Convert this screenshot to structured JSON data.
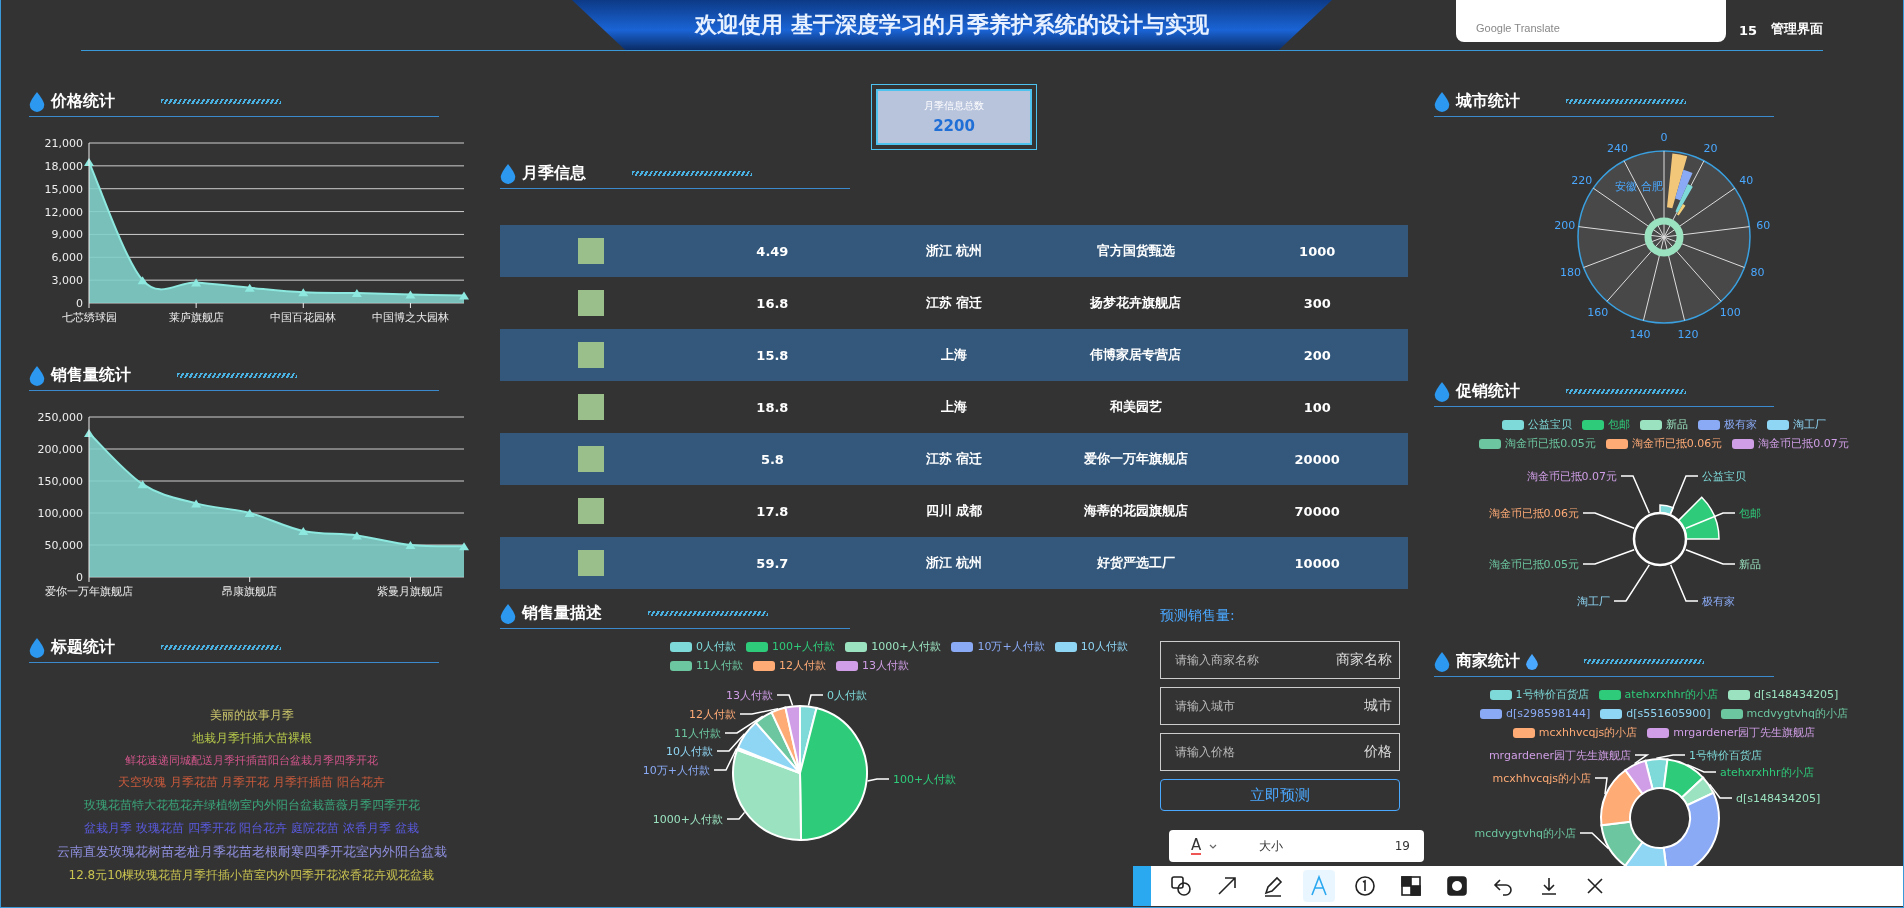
{
  "header": {
    "title": "欢迎使用 基于深度学习的月季养护系统的设计与实现",
    "time_fragment": "15",
    "admin_label": "管理界面"
  },
  "translate_popup": {
    "label": "Google Translate"
  },
  "price_stats": {
    "title": "价格统计",
    "chart_data": {
      "type": "area",
      "categories": [
        "七芯绣球园",
        null,
        "莱庐旗舰店",
        null,
        "中国百花园林",
        null,
        "中国博之大园林",
        null
      ],
      "values": [
        18500,
        3000,
        2700,
        2000,
        1400,
        1300,
        1100,
        1000
      ],
      "ylim": [
        0,
        21000
      ],
      "grid": true,
      "yticks": [
        {
          "value": 0,
          "label": "0"
        },
        {
          "value": 3000,
          "label": "3,000"
        },
        {
          "value": 6000,
          "label": "6,000"
        },
        {
          "value": 9000,
          "label": "9,000"
        },
        {
          "value": 12000,
          "label": "12,000"
        },
        {
          "value": 15000,
          "label": "15,000"
        },
        {
          "value": 18000,
          "label": "18,000"
        },
        {
          "value": 21000,
          "label": "21,000"
        }
      ]
    }
  },
  "sales_stats": {
    "title": "销售量统计",
    "chart_data": {
      "type": "area",
      "categories": [
        "爱你一万年旗舰店",
        null,
        null,
        "昂康旗舰店",
        null,
        null,
        "紫曼月旗舰店",
        null
      ],
      "values": [
        225000,
        145000,
        115000,
        100000,
        72000,
        65000,
        50000,
        48000
      ],
      "ylim": [
        0,
        250000
      ],
      "grid": true,
      "yticks": [
        {
          "value": 0,
          "label": "0"
        },
        {
          "value": 50000,
          "label": "50,000"
        },
        {
          "value": 100000,
          "label": "100,000"
        },
        {
          "value": 150000,
          "label": "150,000"
        },
        {
          "value": 200000,
          "label": "200,000"
        },
        {
          "value": 250000,
          "label": "250,000"
        }
      ]
    }
  },
  "title_stats": {
    "title": "标题统计",
    "words": [
      {
        "text": "美丽的故事月季",
        "color": "#c9c46a"
      },
      {
        "text": "地栽月季扦插大苗裸根",
        "color": "#b7c84a"
      },
      {
        "text": "鲜花速递同城配送月季扦插苗阳台盆栽月季四季开花",
        "color": "#d0558a"
      },
      {
        "text": "天空玫瑰 月季花苗 月季开花 月季扦插苗 阳台花卉",
        "color": "#c85a3c"
      },
      {
        "text": "玫瑰花苗特大花苞花卉绿植物室内外阳台盆栽蔷薇月季四季开花",
        "color": "#3aa57a"
      },
      {
        "text": "盆栽月季 玫瑰花苗 四季开花 阳台花卉 庭院花苗 浓香月季 盆栽",
        "color": "#5a5ae0"
      },
      {
        "text": "云南直发玫瑰花树苗老桩月季花苗老根耐寒四季开花室内外阳台盆栽",
        "color": "#8f8fe0"
      },
      {
        "text": "12.8元10棵玫瑰花苗月季扦插小苗室内外四季开花浓香花卉观花盆栽",
        "color": "#c9c350"
      }
    ]
  },
  "total": {
    "label": "月季信息总数",
    "value": "2200"
  },
  "flower_info": {
    "title": "月季信息",
    "rows": [
      {
        "price": "4.49",
        "city": "浙江 杭州",
        "shop": "官方国货甄选",
        "sales": "1000"
      },
      {
        "price": "16.8",
        "city": "江苏 宿迁",
        "shop": "扬梦花卉旗舰店",
        "sales": "300"
      },
      {
        "price": "15.8",
        "city": "上海",
        "shop": "伟博家居专营店",
        "sales": "200"
      },
      {
        "price": "18.8",
        "city": "上海",
        "shop": "和美园艺",
        "sales": "100"
      },
      {
        "price": "5.8",
        "city": "江苏 宿迁",
        "shop": "爱你一万年旗舰店",
        "sales": "20000"
      },
      {
        "price": "17.8",
        "city": "四川 成都",
        "shop": "海蒂的花园旗舰店",
        "sales": "70000"
      },
      {
        "price": "59.7",
        "city": "浙江 杭州",
        "shop": "好货严选工厂",
        "sales": "10000"
      }
    ]
  },
  "sales_desc": {
    "title": "销售量描述",
    "legend": [
      {
        "label": "0人付款",
        "color": "#7ed9d9"
      },
      {
        "label": "100+人付款",
        "color": "#2ecc7a"
      },
      {
        "label": "1000+人付款",
        "color": "#9be3c0"
      },
      {
        "label": "10万+人付款",
        "color": "#8aaaf5"
      },
      {
        "label": "10人付款",
        "color": "#8fd6f5"
      },
      {
        "label": "11人付款",
        "color": "#6cc6a0"
      },
      {
        "label": "12人付款",
        "color": "#ffab76"
      },
      {
        "label": "13人付款",
        "color": "#d09ee6"
      }
    ],
    "callouts": [
      "13人付款",
      "0人付款",
      "12人付款",
      "11人付款",
      "10人付款",
      "10万+人付款",
      "100+人付款",
      "1000+人付款"
    ]
  },
  "prediction": {
    "title": "预测销售量:",
    "fields": [
      {
        "placeholder": "请输入商家名称",
        "label": "商家名称"
      },
      {
        "placeholder": "请输入城市",
        "label": "城市"
      },
      {
        "placeholder": "请输入价格",
        "label": "价格"
      }
    ],
    "button": "立即预测"
  },
  "city_stats": {
    "title": "城市统计",
    "angle_ticks": [
      "0",
      "20",
      "40",
      "60",
      "80",
      "100",
      "120",
      "140",
      "160",
      "180",
      "200",
      "220",
      "240"
    ],
    "series_label": "安徽 合肥"
  },
  "promo_stats": {
    "title": "促销统计",
    "legend": [
      {
        "label": "公益宝贝",
        "color": "#7ed9d9"
      },
      {
        "label": "包邮",
        "color": "#2ecc7a"
      },
      {
        "label": "新品",
        "color": "#9be3c0"
      },
      {
        "label": "极有家",
        "color": "#8aaaf5"
      },
      {
        "label": "淘工厂",
        "color": "#8fd6f5"
      },
      {
        "label": "淘金币已抵0.05元",
        "color": "#6cc6a0"
      },
      {
        "label": "淘金币已抵0.06元",
        "color": "#ffab76"
      },
      {
        "label": "淘金币已抵0.07元",
        "color": "#d09ee6"
      }
    ],
    "callouts": [
      "淘金币已抵0.07元",
      "公益宝贝",
      "淘金币已抵0.06元",
      "包邮",
      "淘金币已抵0.05元",
      "新品",
      "淘工厂",
      "极有家"
    ]
  },
  "merchant_stats": {
    "title": "商家统计",
    "legend": [
      {
        "label": "1号特价百货店",
        "color": "#7ed9d9"
      },
      {
        "label": "atehxrxhhr的小店",
        "color": "#2ecc7a"
      },
      {
        "label": "d[s148434205]",
        "color": "#9be3c0"
      },
      {
        "label": "d[s298598144]",
        "color": "#8aaaf5"
      },
      {
        "label": "d[s551605900]",
        "color": "#8fd6f5"
      },
      {
        "label": "mcdvygtvhq的小店",
        "color": "#6cc6a0"
      },
      {
        "label": "mcxhhvcqjs的小店",
        "color": "#ffab76"
      },
      {
        "label": "mrgardener园丁先生旗舰店",
        "color": "#d09ee6"
      }
    ],
    "callouts": [
      "mrgardener园丁先生旗舰店",
      "1号特价百货店",
      "atehxrxhhr的小店",
      "mcxhhvcqjs的小店",
      "d[s148434205]",
      "mcdvygtvhq的小店"
    ]
  },
  "size_popup": {
    "font_glyph": "A",
    "label": "大小",
    "value": "19"
  },
  "toolbar": {
    "tools": [
      {
        "kind": "shape",
        "selected": false
      },
      {
        "kind": "arrow",
        "selected": false
      },
      {
        "kind": "pencil",
        "selected": false
      },
      {
        "kind": "text",
        "selected": true
      },
      {
        "kind": "number",
        "selected": false
      },
      {
        "kind": "mosaic",
        "selected": false
      },
      {
        "kind": "record",
        "selected": false
      },
      {
        "kind": "undo",
        "selected": false
      },
      {
        "kind": "download",
        "selected": false
      },
      {
        "kind": "close",
        "selected": false
      }
    ]
  }
}
